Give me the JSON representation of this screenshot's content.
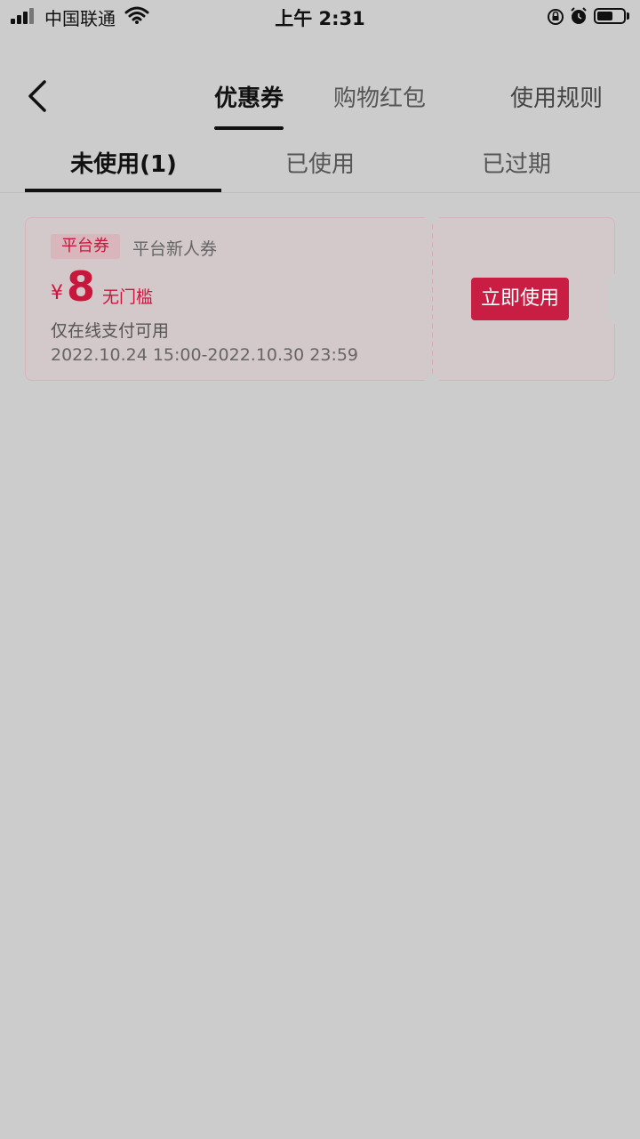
{
  "status_bar": {
    "carrier": "中国联通",
    "time": "上午 2:31",
    "battery_level": 0.6
  },
  "header": {
    "tabs": [
      {
        "label": "优惠券",
        "active": true
      },
      {
        "label": "购物红包",
        "active": false
      }
    ],
    "rules_label": "使用规则"
  },
  "sub_tabs": [
    {
      "label": "未使用(1)",
      "active": true
    },
    {
      "label": "已使用",
      "active": false
    },
    {
      "label": "已过期",
      "active": false
    }
  ],
  "coupon": {
    "tag": "平台券",
    "name": "平台新人券",
    "currency": "¥",
    "amount": "8",
    "threshold": "无门槛",
    "usage_note": "仅在线支付可用",
    "validity": "2022.10.24 15:00-2022.10.30 23:59",
    "button_label": "立即使用"
  },
  "colors": {
    "accent": "#c8173c",
    "background": "#cccccc"
  }
}
